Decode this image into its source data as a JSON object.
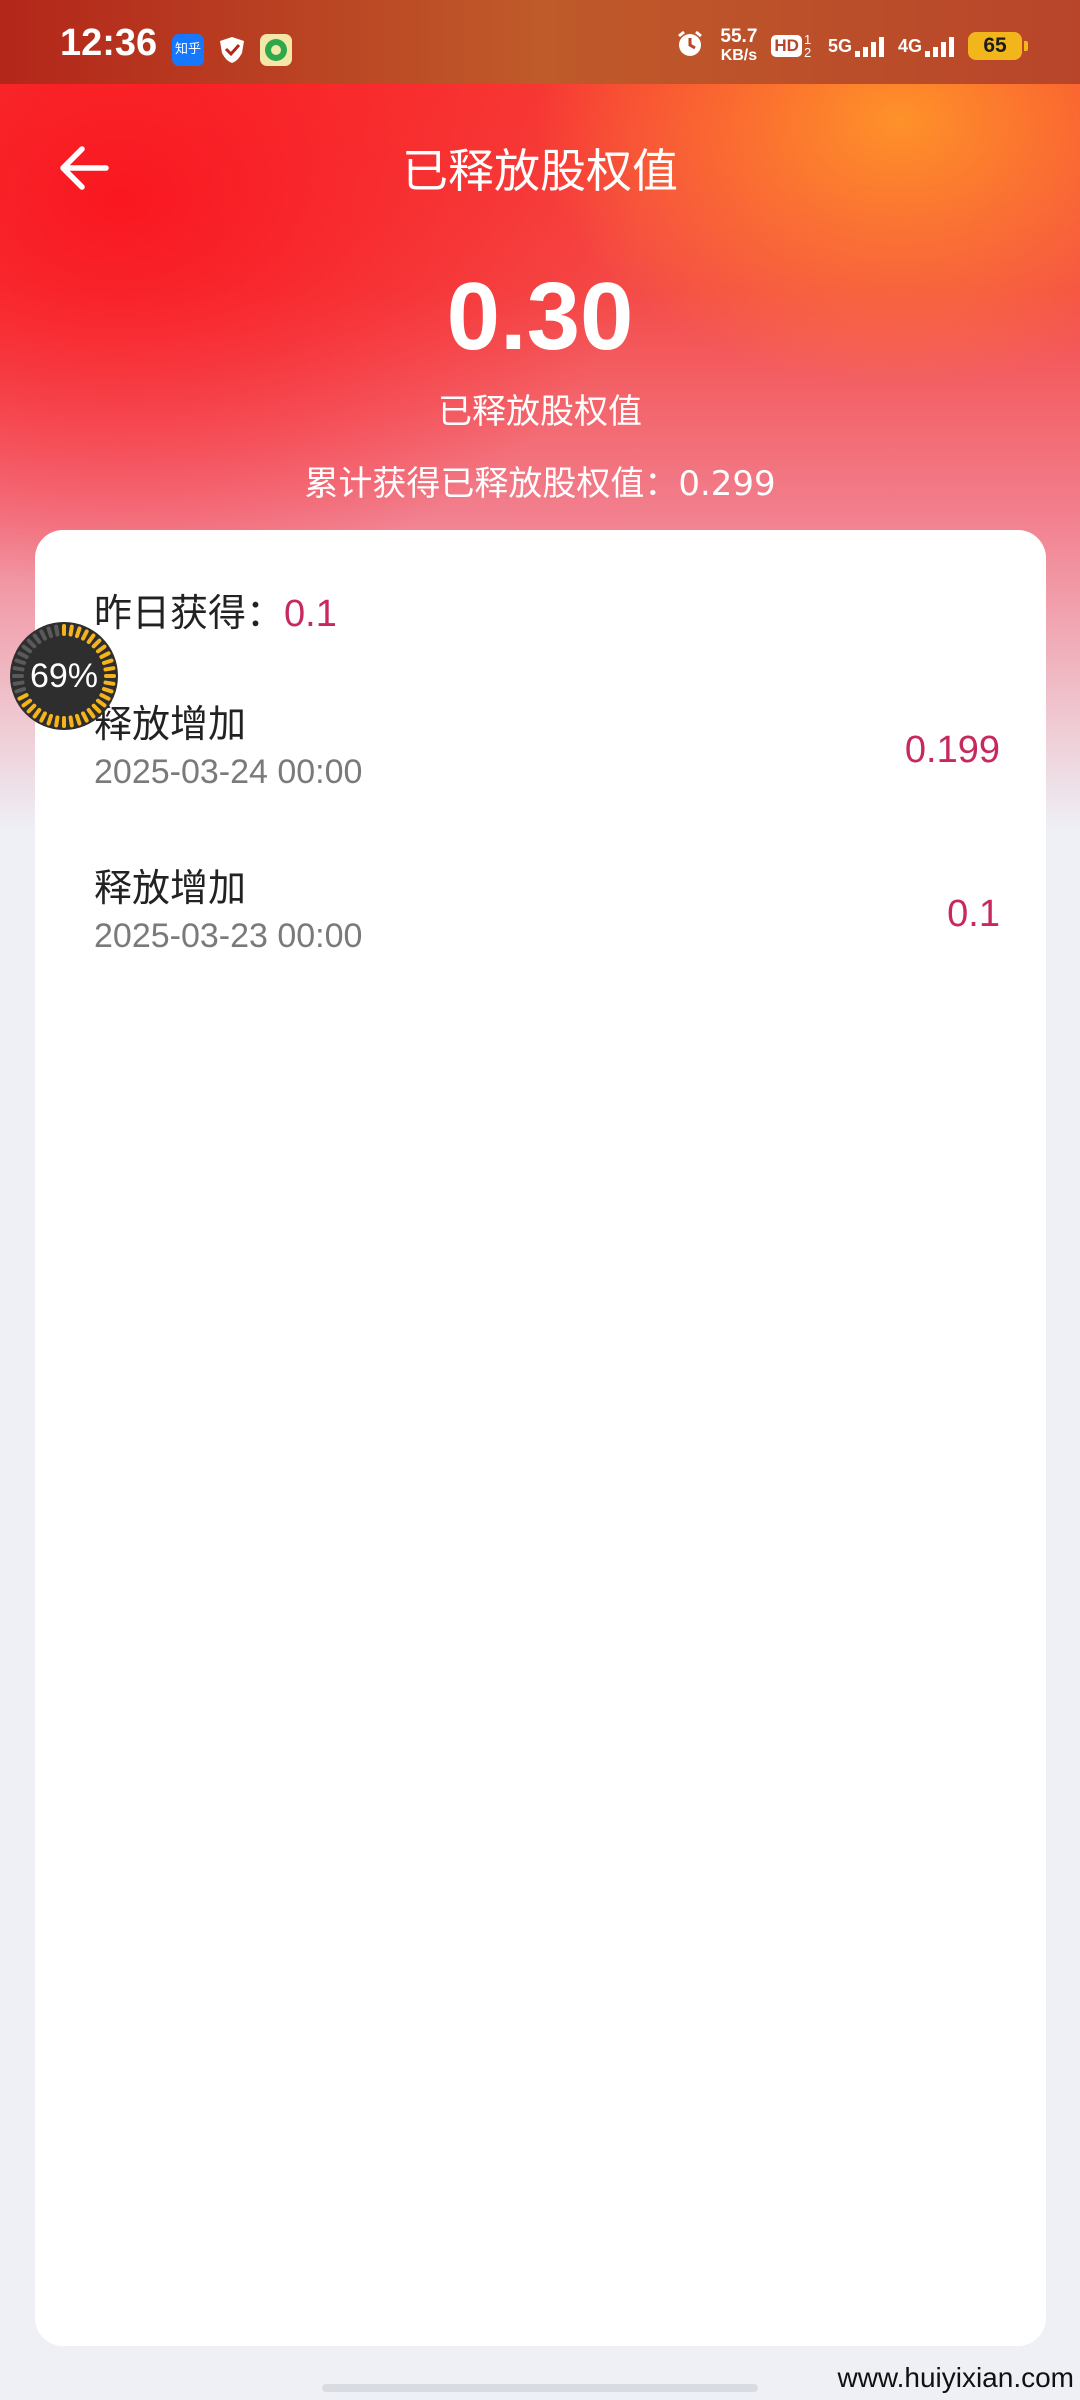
{
  "status_bar": {
    "time": "12:36",
    "app_icons": [
      "zhihu-app-icon",
      "security-shield-icon",
      "green-app-icon"
    ],
    "app_icon_label": "知乎",
    "network_speed_value": "55.7",
    "network_speed_unit": "KB/s",
    "hd_label": "HD",
    "hd_sub": "1 2",
    "net_5g": "5G",
    "net_4g": "4G",
    "battery": "65"
  },
  "header": {
    "title": "已释放股权值"
  },
  "summary": {
    "value": "0.30",
    "label": "已释放股权值",
    "cumulative_text": "累计获得已释放股权值：0.299"
  },
  "card": {
    "yesterday_label": "昨日获得：",
    "yesterday_value": "0.1",
    "records": [
      {
        "title": "释放增加",
        "date": "2025-03-24 00:00",
        "amount": "0.199"
      },
      {
        "title": "释放增加",
        "date": "2025-03-23 00:00",
        "amount": "0.1"
      }
    ]
  },
  "floating_widget": {
    "percent_text": "69%",
    "percent": 69
  },
  "watermark": "www.huiyixian.com",
  "colors": {
    "accent": "#c8295c",
    "hero_red": "#f7372f",
    "hero_orange": "#ff962a",
    "page_bg": "#eef0f6"
  }
}
